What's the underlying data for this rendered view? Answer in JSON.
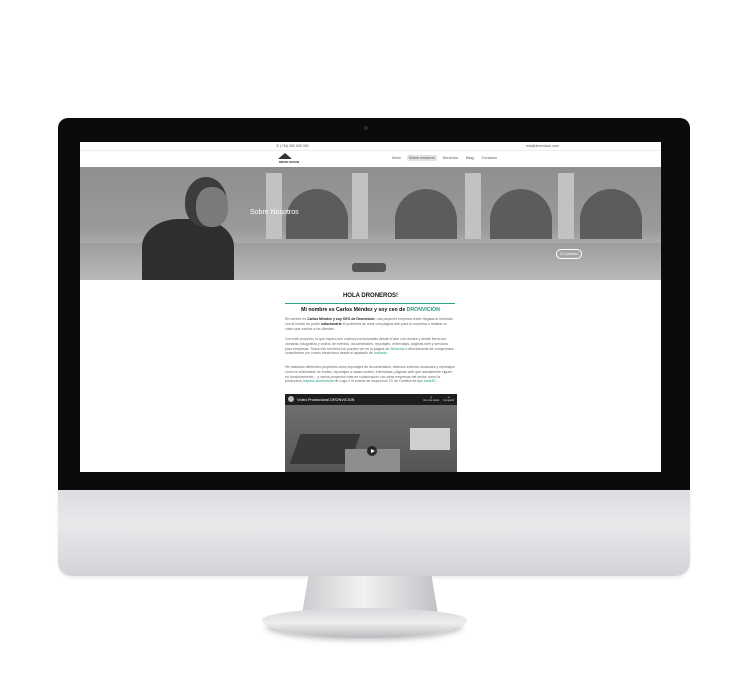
{
  "topbar": {
    "phone": "✆ (+34) 000 000 000",
    "email": "info@dronvicion.com"
  },
  "logo": {
    "text": "DRON VICION"
  },
  "nav": {
    "items": [
      "Inicio",
      "Sobre nosotros",
      "Servicios",
      "Blog",
      "Contacto"
    ]
  },
  "hero": {
    "title": "Sobre Nosotros",
    "button_label": "Contacto"
  },
  "content": {
    "greeting": "HOLA DRONEROS!",
    "subtitle_prefix": "Mi nombre es Carlos Méndez y soy ceo de ",
    "subtitle_brand": "DRONVICION",
    "p1_a": "Mi nombre es ",
    "p1_b": "Carlos Méndez y soy CEO de Dronvicion",
    "p1_c": ", una pequeña empresa recién llegada al mercado con la ilusión de poder ",
    "p1_d": "solucionarle",
    "p1_e": " el problema de crear una página web para tu empresa o realizar un vídeo que cautive a los clientes.",
    "p2_a": "Con este proyecto, lo que espero son vídeos promocionales desde el aire con drones y desde tierra con cámaras, fotografías y vídeos de eventos, documentales, reportajes, entrevistas, páginas web y servicios para empresas. Todos mis servicios los puedes ver en la página de ",
    "p2_link1": "Servicios",
    "p2_b": " o directamente sin compromiso consultarme por correo electrónico desde el apartado de ",
    "p2_link2": "contacto",
    "p2_c": ".",
    "p3_a": "He realizado diferentes proyectos como reportajes de documentales, diversos eventos musicales y reportajes como la celebración de bodas, reportajes a casas rurales, entrevistas, páginas web que actualmente siguen en funcionamiento... y varios proyectos más en colaboración con otras empresas del sector como la productora ",
    "p3_link1": "Impulso Audiovisual",
    "p3_b": " de Lugo o el evento de inspección TC de Cedeira de tipo ",
    "p3_link2": "trails3D",
    "p3_c": "."
  },
  "video": {
    "title": "Vídeo Promocional DRONVICION",
    "action1": "Ver más tarde",
    "action2": "Compartir"
  }
}
